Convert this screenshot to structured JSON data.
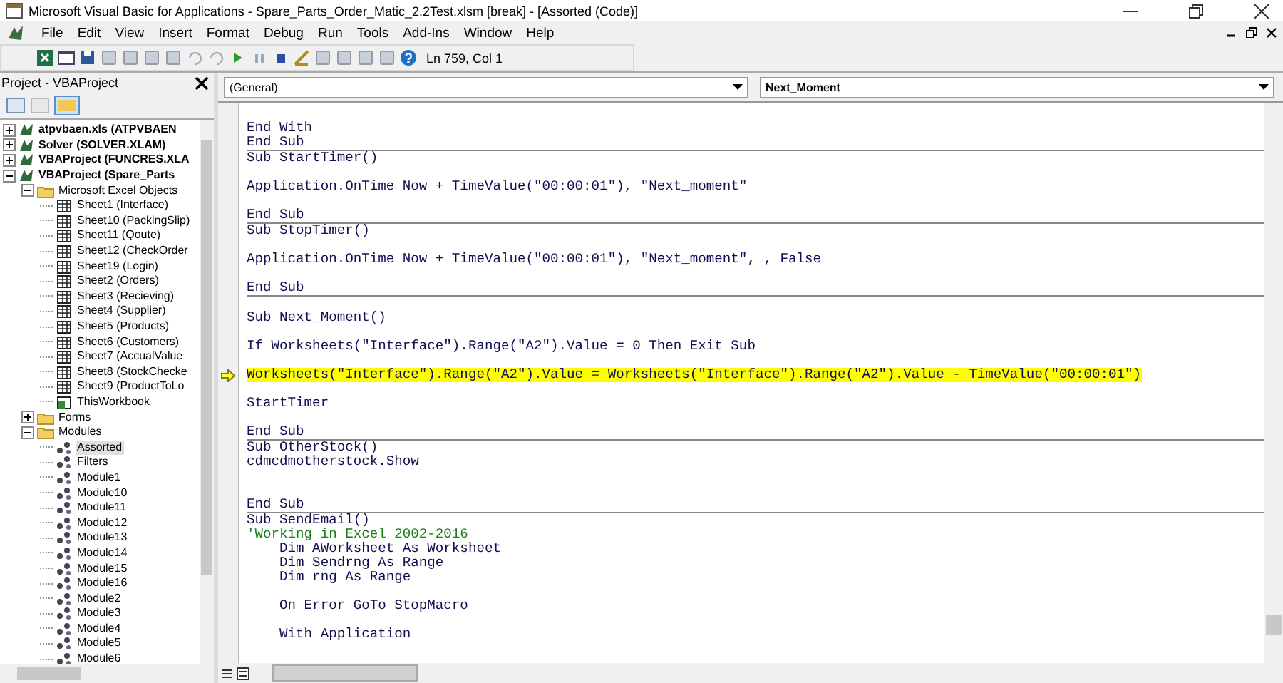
{
  "window": {
    "title": "Microsoft Visual Basic for Applications - Spare_Parts_Order_Matic_2.2Test.xlsm [break] - [Assorted (Code)]"
  },
  "menu": [
    "File",
    "Edit",
    "View",
    "Insert",
    "Format",
    "Debug",
    "Run",
    "Tools",
    "Add-Ins",
    "Window",
    "Help"
  ],
  "toolbar": {
    "position": "Ln 759, Col 1"
  },
  "project_pane": {
    "title": "Project - VBAProject",
    "tree": [
      {
        "label": "atpvbaen.xls (ATPVBAEN",
        "kind": "project",
        "expanded": false,
        "selected": false
      },
      {
        "label": "Solver (SOLVER.XLAM)",
        "kind": "project",
        "expanded": false,
        "selected": false
      },
      {
        "label": "VBAProject (FUNCRES.XLA",
        "kind": "project",
        "expanded": false,
        "selected": false
      },
      {
        "label": "VBAProject (Spare_Parts",
        "kind": "project",
        "expanded": true,
        "selected": false,
        "children": [
          {
            "label": "Microsoft Excel Objects",
            "kind": "folder",
            "expanded": true,
            "selected": false,
            "children": [
              {
                "label": "Sheet1 (Interface)",
                "kind": "sheet",
                "selected": false
              },
              {
                "label": "Sheet10 (PackingSlip)",
                "kind": "sheet",
                "selected": false
              },
              {
                "label": "Sheet11 (Qoute)",
                "kind": "sheet",
                "selected": false
              },
              {
                "label": "Sheet12 (CheckOrder",
                "kind": "sheet",
                "selected": false
              },
              {
                "label": "Sheet19 (Login)",
                "kind": "sheet",
                "selected": false
              },
              {
                "label": "Sheet2 (Orders)",
                "kind": "sheet",
                "selected": false
              },
              {
                "label": "Sheet3 (Recieving)",
                "kind": "sheet",
                "selected": false
              },
              {
                "label": "Sheet4 (Supplier)",
                "kind": "sheet",
                "selected": false
              },
              {
                "label": "Sheet5 (Products)",
                "kind": "sheet",
                "selected": false
              },
              {
                "label": "Sheet6 (Customers)",
                "kind": "sheet",
                "selected": false
              },
              {
                "label": "Sheet7 (AccualValue",
                "kind": "sheet",
                "selected": false
              },
              {
                "label": "Sheet8 (StockChecke",
                "kind": "sheet",
                "selected": false
              },
              {
                "label": "Sheet9 (ProductToLo",
                "kind": "sheet",
                "selected": false
              },
              {
                "label": "ThisWorkbook",
                "kind": "workbook",
                "selected": false
              }
            ]
          },
          {
            "label": "Forms",
            "kind": "folder",
            "expanded": false,
            "selected": false
          },
          {
            "label": "Modules",
            "kind": "folder",
            "expanded": true,
            "selected": false,
            "children": [
              {
                "label": "Assorted",
                "kind": "module",
                "selected": true
              },
              {
                "label": "Filters",
                "kind": "module",
                "selected": false
              },
              {
                "label": "Module1",
                "kind": "module",
                "selected": false
              },
              {
                "label": "Module10",
                "kind": "module",
                "selected": false
              },
              {
                "label": "Module11",
                "kind": "module",
                "selected": false
              },
              {
                "label": "Module12",
                "kind": "module",
                "selected": false
              },
              {
                "label": "Module13",
                "kind": "module",
                "selected": false
              },
              {
                "label": "Module14",
                "kind": "module",
                "selected": false
              },
              {
                "label": "Module15",
                "kind": "module",
                "selected": false
              },
              {
                "label": "Module16",
                "kind": "module",
                "selected": false
              },
              {
                "label": "Module2",
                "kind": "module",
                "selected": false
              },
              {
                "label": "Module3",
                "kind": "module",
                "selected": false
              },
              {
                "label": "Module4",
                "kind": "module",
                "selected": false
              },
              {
                "label": "Module5",
                "kind": "module",
                "selected": false
              },
              {
                "label": "Module6",
                "kind": "module",
                "selected": false
              }
            ]
          }
        ]
      }
    ]
  },
  "code_window": {
    "object_dropdown": "(General)",
    "procedure_dropdown": "Next_Moment",
    "blocks": [
      [
        {
          "kind": "blank"
        },
        {
          "kind": "code",
          "text": "End With"
        },
        {
          "kind": "code",
          "text": "End Sub"
        }
      ],
      [
        {
          "kind": "code",
          "text": "Sub StartTimer()"
        },
        {
          "kind": "blank"
        },
        {
          "kind": "code",
          "text": "Application.OnTime Now + TimeValue(\"00:00:01\"), \"Next_moment\""
        },
        {
          "kind": "blank"
        },
        {
          "kind": "code",
          "text": "End Sub"
        }
      ],
      [
        {
          "kind": "code",
          "text": "Sub StopTimer()"
        },
        {
          "kind": "blank"
        },
        {
          "kind": "code",
          "text": "Application.OnTime Now + TimeValue(\"00:00:01\"), \"Next_moment\", , False"
        },
        {
          "kind": "blank"
        },
        {
          "kind": "code",
          "text": "End Sub"
        }
      ],
      [
        {
          "kind": "blank"
        },
        {
          "kind": "code",
          "text": "Sub Next_Moment()"
        },
        {
          "kind": "blank"
        },
        {
          "kind": "code",
          "text": "If Worksheets(\"Interface\").Range(\"A2\").Value = 0 Then Exit Sub"
        },
        {
          "kind": "blank"
        },
        {
          "kind": "current",
          "text": "Worksheets(\"Interface\").Range(\"A2\").Value = Worksheets(\"Interface\").Range(\"A2\").Value - TimeValue(\"00:00:01\")"
        },
        {
          "kind": "blank"
        },
        {
          "kind": "code",
          "text": "StartTimer"
        },
        {
          "kind": "blank"
        },
        {
          "kind": "code",
          "text": "End Sub"
        }
      ],
      [
        {
          "kind": "code",
          "text": "Sub OtherStock()"
        },
        {
          "kind": "code",
          "text": "cdmcdmotherstock.Show"
        },
        {
          "kind": "blank"
        },
        {
          "kind": "blank"
        },
        {
          "kind": "code",
          "text": "End Sub"
        }
      ],
      [
        {
          "kind": "code",
          "text": "Sub SendEmail()"
        },
        {
          "kind": "comment",
          "text": "'Working in Excel 2002-2016"
        },
        {
          "kind": "code",
          "text": "    Dim AWorksheet As Worksheet"
        },
        {
          "kind": "code",
          "text": "    Dim Sendrng As Range"
        },
        {
          "kind": "code",
          "text": "    Dim rng As Range"
        },
        {
          "kind": "blank"
        },
        {
          "kind": "code",
          "text": "    On Error GoTo StopMacro"
        },
        {
          "kind": "blank"
        },
        {
          "kind": "code",
          "text": "    With Application"
        }
      ]
    ]
  }
}
